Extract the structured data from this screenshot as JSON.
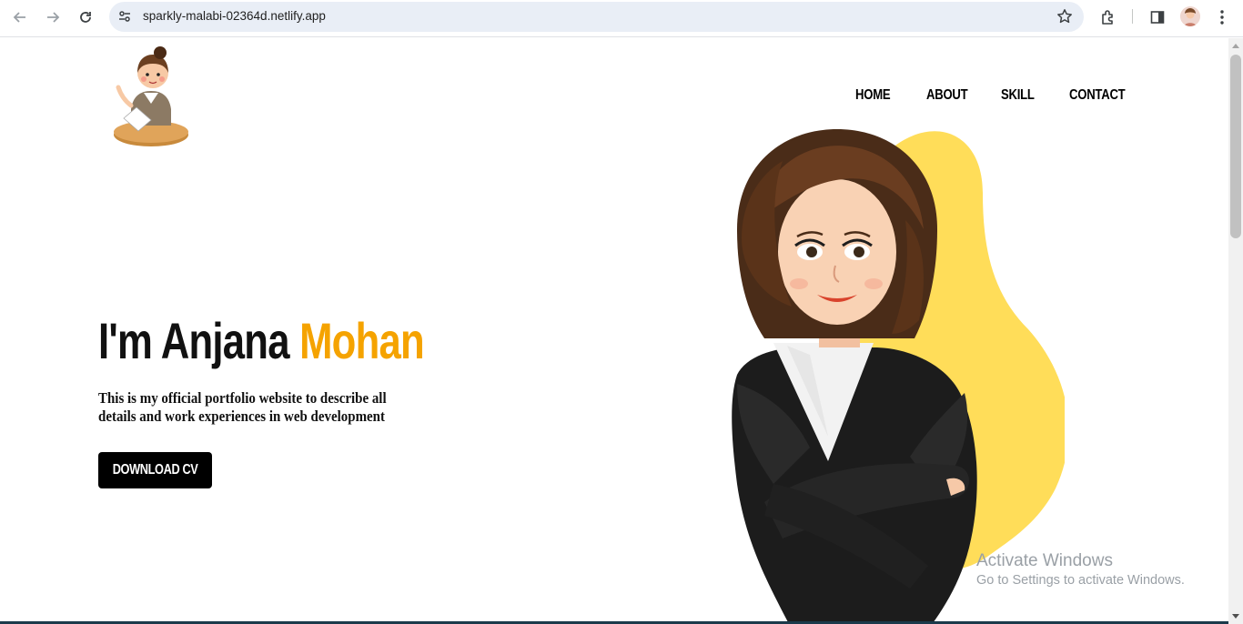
{
  "browser": {
    "url": "sparkly-malabi-02364d.netlify.app",
    "icons": [
      "back-arrow-icon",
      "forward-arrow-icon",
      "reload-icon",
      "site-info-icon",
      "bookmark-star-icon",
      "extensions-icon",
      "side-panel-icon",
      "profile-avatar-icon",
      "menu-kebab-icon"
    ]
  },
  "nav": {
    "items": [
      {
        "label": "HOME"
      },
      {
        "label": "ABOUT"
      },
      {
        "label": "SKILL"
      },
      {
        "label": "CONTACT"
      }
    ]
  },
  "hero": {
    "title_prefix": "I'm Anjana ",
    "title_accent": "Mohan",
    "description": "This is my official portfolio website to describe all details and work experiences in web development",
    "button_label": "DOWNLOAD CV"
  },
  "watermark": {
    "title": "Activate Windows",
    "subtitle": "Go to Settings to activate Windows."
  },
  "colors": {
    "accent": "#f5a300",
    "blob": "#ffdd59",
    "button": "#000000"
  }
}
